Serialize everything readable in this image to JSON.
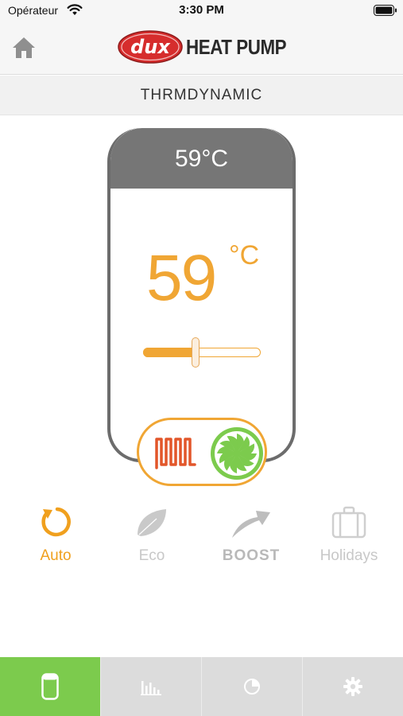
{
  "status_bar": {
    "carrier": "Opérateur",
    "time": "3:30 PM",
    "wifi_icon": "wifi-icon",
    "battery_icon": "battery-icon"
  },
  "header": {
    "home_icon": "home-icon",
    "logo_text": "dux",
    "brand_text": "HEAT PUMP"
  },
  "model": {
    "name": "THRMDYNAMIC"
  },
  "tank": {
    "current_temp": "59°C",
    "setpoint_value": "59",
    "setpoint_unit": "°C",
    "setpoint_slider_fraction": 0.44,
    "heater_icon": "heating-element-icon",
    "fan_icon": "fan-icon"
  },
  "modes": [
    {
      "id": "auto",
      "label": "Auto",
      "icon": "auto-cycle-icon",
      "active": true
    },
    {
      "id": "eco",
      "label": "Eco",
      "icon": "leaf-icon",
      "active": false
    },
    {
      "id": "boost",
      "label": "BOOST",
      "icon": "boost-arrow-icon",
      "active": false
    },
    {
      "id": "holidays",
      "label": "Holidays",
      "icon": "suitcase-icon",
      "active": false
    }
  ],
  "tabs": [
    {
      "id": "tank",
      "icon": "tank-icon",
      "active": true
    },
    {
      "id": "stats",
      "icon": "bar-chart-icon",
      "active": false
    },
    {
      "id": "schedule",
      "icon": "pie-chart-icon",
      "active": false
    },
    {
      "id": "settings",
      "icon": "gear-icon",
      "active": false
    }
  ],
  "colors": {
    "accent": "#f0a634",
    "active_tab": "#7ccb4d",
    "tank_cap": "#767676",
    "heater": "#e2562a",
    "fan": "#7ccb4d",
    "logo_red": "#d62d2d"
  }
}
